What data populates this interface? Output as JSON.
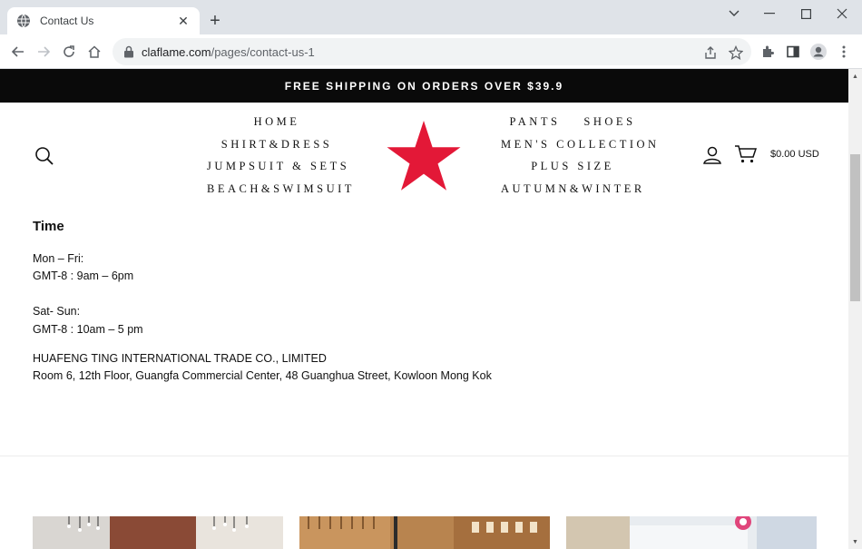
{
  "browser": {
    "tab_title": "Contact Us",
    "url_domain": "claflame.com",
    "url_path": "/pages/contact-us-1"
  },
  "announcement": "FREE SHIPPING ON ORDERS OVER $39.9",
  "nav": {
    "left": [
      "HOME",
      "SHIRT&DRESS",
      "JUMPSUIT & SETS",
      "BEACH&SWIMSUIT"
    ],
    "right_pants": "PANTS",
    "right_shoes": "SHOES",
    "right": [
      "MEN'S COLLECTION",
      "PLUS SIZE",
      "AUTUMN&WINTER"
    ]
  },
  "cart": {
    "total": "$0.00 USD"
  },
  "content": {
    "heading": "Time",
    "weekday_label": "Mon – Fri:",
    "weekday_hours": "GMT-8 : 9am – 6pm",
    "weekend_label": "Sat- Sun:",
    "weekend_hours": "GMT-8 : 10am – 5 pm",
    "company": "HUAFENG TING INTERNATIONAL TRADE CO., LIMITED",
    "address": "Room 6, 12th Floor, Guangfa Commercial Center, 48 Guanghua Street, Kowloon Mong Kok"
  },
  "colors": {
    "announcement_bg": "#0a0a0a",
    "logo_star": "#e31837",
    "tabstrip_bg": "#dfe3e8"
  },
  "icons": [
    "globe-icon",
    "close-icon",
    "plus-icon",
    "chevron-down-icon",
    "minimize-icon",
    "maximize-icon",
    "back-icon",
    "forward-icon",
    "reload-icon",
    "home-icon",
    "lock-icon",
    "share-icon",
    "star-icon",
    "extensions-icon",
    "sidepanel-icon",
    "profile-icon",
    "kebab-menu-icon",
    "search-icon",
    "account-icon",
    "cart-icon"
  ]
}
